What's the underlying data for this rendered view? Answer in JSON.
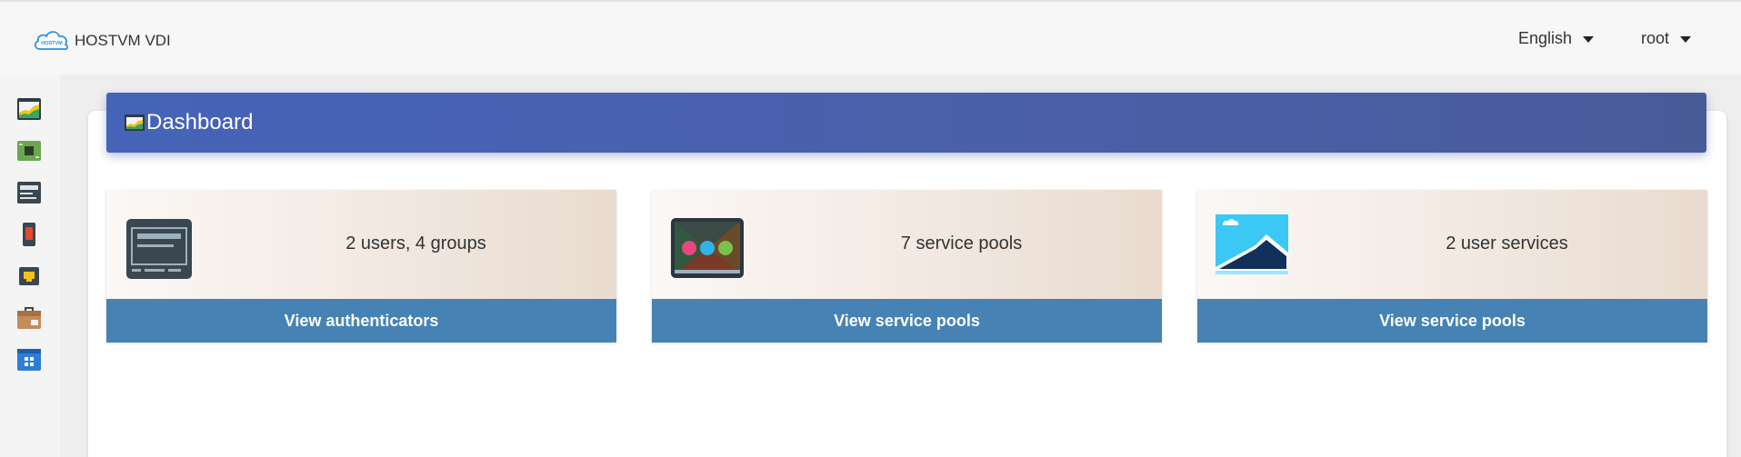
{
  "header": {
    "brand": "HOSTVM VDI",
    "logo_text": "HOSTVM",
    "language": "English",
    "user": "root"
  },
  "sidebar": {
    "items": [
      {
        "icon": "dashboard-chart-icon"
      },
      {
        "icon": "circuit-board-icon"
      },
      {
        "icon": "server-rack-icon"
      },
      {
        "icon": "power-switch-icon"
      },
      {
        "icon": "network-port-icon"
      },
      {
        "icon": "toolbox-icon"
      },
      {
        "icon": "app-grid-icon"
      }
    ]
  },
  "dashboard": {
    "title": "Dashboard",
    "cards": [
      {
        "text": "2 users, 4 groups",
        "button": "View authenticators",
        "icon": "authenticator-terminal-icon"
      },
      {
        "text": "7 service pools",
        "button": "View service pools",
        "icon": "service-pools-icon"
      },
      {
        "text": "2 user services",
        "button": "View service pools",
        "icon": "user-services-landscape-icon"
      }
    ]
  },
  "colors": {
    "header_gradient_start": "#4563b8",
    "button": "#4682b4",
    "card_gradient_end": "#e9dbcf"
  }
}
